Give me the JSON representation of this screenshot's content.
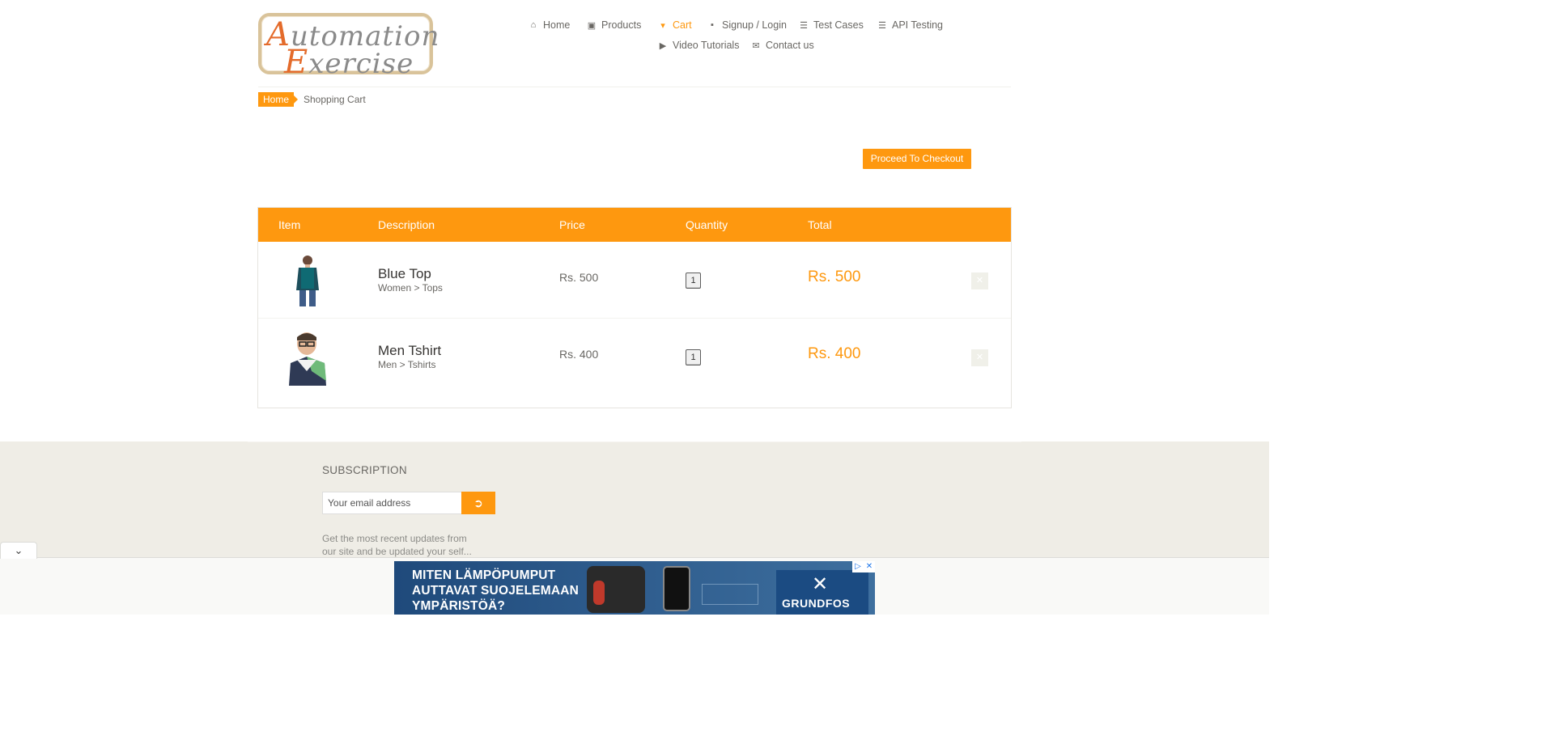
{
  "logo": {
    "line1_cap": "A",
    "line1_rest": "utomation",
    "line2_cap": "E",
    "line2_rest": "xercise"
  },
  "nav": {
    "home": "Home",
    "products": "Products",
    "cart": "Cart",
    "signup_login": "Signup / Login",
    "test_cases": "Test Cases",
    "api_testing": "API Testing",
    "video_tutorials": "Video Tutorials",
    "contact_us": "Contact us"
  },
  "breadcrumb": {
    "home": "Home",
    "current": "Shopping Cart"
  },
  "checkout_button": "Proceed To Checkout",
  "cart": {
    "headers": {
      "item": "Item",
      "description": "Description",
      "price": "Price",
      "quantity": "Quantity",
      "total": "Total"
    },
    "rows": [
      {
        "name": "Blue Top",
        "category": "Women > Tops",
        "price": "Rs. 500",
        "quantity": "1",
        "total": "Rs. 500"
      },
      {
        "name": "Men Tshirt",
        "category": "Men > Tshirts",
        "price": "Rs. 400",
        "quantity": "1",
        "total": "Rs. 400"
      }
    ]
  },
  "subscription": {
    "title": "SUBSCRIPTION",
    "email_placeholder": "Your email address",
    "description": "Get the most recent updates from our site and be updated your self..."
  },
  "ad": {
    "headline": "MITEN LÄMPÖPUMPUT\nAUTTAVAT SUOJELEMAAN\nYMPÄRISTÖÄ?",
    "brand": "GRUNDFOS"
  },
  "colors": {
    "accent": "#fe980f",
    "text": "#696763",
    "footer_bg": "#efede6"
  }
}
